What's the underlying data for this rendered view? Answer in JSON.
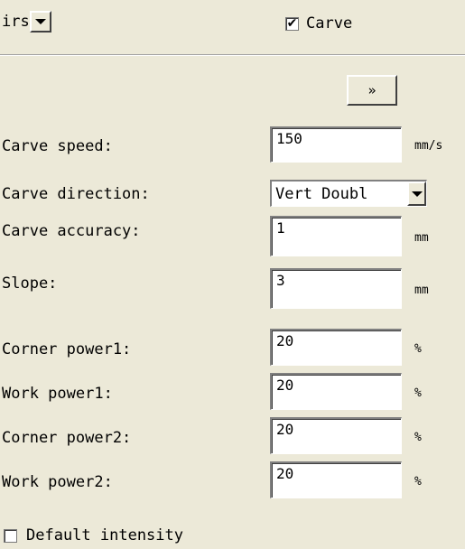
{
  "top": {
    "select_value": "irs",
    "carve_label": "Carve",
    "carve_checked": true
  },
  "expand_button": "»",
  "fields": [
    {
      "label": "Carve speed:",
      "value": "150",
      "unit": "mm/s"
    },
    {
      "label": "Carve direction:",
      "value": "Vert Doubl",
      "unit": ""
    },
    {
      "label": "Carve accuracy:",
      "value": "1",
      "unit": "mm"
    },
    {
      "label": "Slope:",
      "value": "3",
      "unit": "mm"
    },
    {
      "label": "Corner power1:",
      "value": "20",
      "unit": "%"
    },
    {
      "label": "Work power1:",
      "value": "20",
      "unit": "%"
    },
    {
      "label": "Corner power2:",
      "value": "20",
      "unit": "%"
    },
    {
      "label": "Work power2:",
      "value": "20",
      "unit": "%"
    }
  ],
  "default_intensity": {
    "label": "Default intensity",
    "checked": false
  }
}
